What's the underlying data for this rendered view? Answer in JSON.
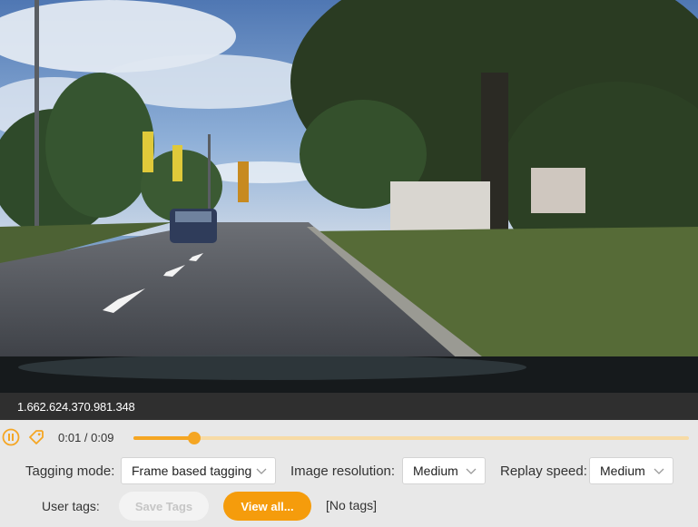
{
  "video": {
    "frame_description_icon": "dashcam-frame",
    "timestamp": "1.662.624.370.981.348"
  },
  "playback": {
    "pause_icon": "pause-icon",
    "tag_icon": "tag-icon",
    "time_display": "0:01 / 0:09",
    "progress_fraction": 0.11
  },
  "settings": {
    "tagging_mode_label": "Tagging mode:",
    "tagging_mode_value": "Frame based tagging",
    "image_resolution_label": "Image resolution:",
    "image_resolution_value": "Medium",
    "replay_speed_label": "Replay speed:",
    "replay_speed_value": "Medium"
  },
  "tags": {
    "user_tags_label": "User tags:",
    "save_tags_label": "Save Tags",
    "view_all_label": "View all...",
    "no_tags_text": "[No tags]"
  },
  "colors": {
    "accent": "#f59c0c",
    "accent_light": "#f7dba6",
    "timestamp_bar": "#2f2f2f",
    "panel_bg": "#e8e8e8"
  }
}
